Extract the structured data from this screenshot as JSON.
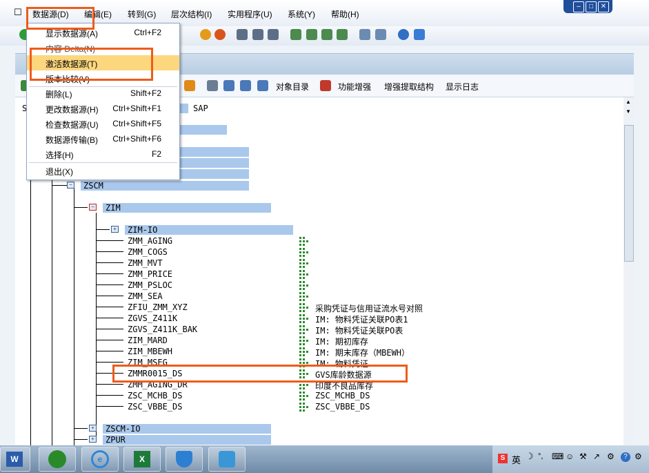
{
  "menubar": {
    "items": [
      "数据源(D)",
      "编辑(E)",
      "转到(G)",
      "层次结构(I)",
      "实用程序(U)",
      "系统(Y)",
      "帮助(H)"
    ]
  },
  "dropdown": {
    "items": [
      {
        "label": "显示数据源(A)",
        "shortcut": "Ctrl+F2"
      },
      {
        "label": "内容 Delta(N)",
        "shortcut": ""
      },
      {
        "label": "激活数据源(T)",
        "shortcut": ""
      },
      {
        "label": "版本比较(V)",
        "shortcut": ""
      },
      {
        "label": "删除(L)",
        "shortcut": "Shift+F2"
      },
      {
        "label": "更改数据源(H)",
        "shortcut": "Ctrl+Shift+F1"
      },
      {
        "label": "检查数据源(U)",
        "shortcut": "Ctrl+Shift+F5"
      },
      {
        "label": "数据源传输(B)",
        "shortcut": "Ctrl+Shift+F6"
      },
      {
        "label": "选择(H)",
        "shortcut": "F2"
      },
      {
        "label": "退出(X)",
        "shortcut": ""
      }
    ]
  },
  "app_toolbar": {
    "labels": [
      "对象目录",
      "功能增强",
      "增强提取结构",
      "显示日志"
    ]
  },
  "tree": {
    "root_label": "SAP",
    "partial_root": "S",
    "zscm": "ZSCM",
    "zim": "ZIM",
    "zim_io": "ZIM-IO",
    "nodes": [
      {
        "name": "ZMM_AGING",
        "desc": ""
      },
      {
        "name": "ZMM_COGS",
        "desc": ""
      },
      {
        "name": "ZMM_MVT",
        "desc": ""
      },
      {
        "name": "ZMM_PRICE",
        "desc": ""
      },
      {
        "name": "ZMM_PSLOC",
        "desc": ""
      },
      {
        "name": "ZMM_SEA",
        "desc": ""
      },
      {
        "name": "ZFIU_ZMM_XYZ",
        "desc": "采购凭证与信用证流水号对照"
      },
      {
        "name": "ZGVS_Z411K",
        "desc": "IM: 物料凭证关联PO表1"
      },
      {
        "name": "ZGVS_Z411K_BAK",
        "desc": "IM: 物料凭证关联PO表"
      },
      {
        "name": "ZIM_MARD",
        "desc": "IM: 期初库存"
      },
      {
        "name": "ZIM_MBEWH",
        "desc": "IM: 期末库存（MBEWH）"
      },
      {
        "name": "ZIM_MSEG",
        "desc": "IM: 物料凭证"
      },
      {
        "name": "ZMMR0015_DS",
        "desc": "GVS库龄数据源"
      },
      {
        "name": "ZMM_AGING_DR",
        "desc": "印度不良品库存"
      },
      {
        "name": "ZSC_MCHB_DS",
        "desc": "ZSC_MCHB_DS"
      },
      {
        "name": "ZSC_VBBE_DS",
        "desc": "ZSC_VBBE_DS"
      }
    ],
    "zscm_io": "ZSCM-IO",
    "zpur": "ZPUR"
  },
  "tray": {
    "ime": "英"
  }
}
